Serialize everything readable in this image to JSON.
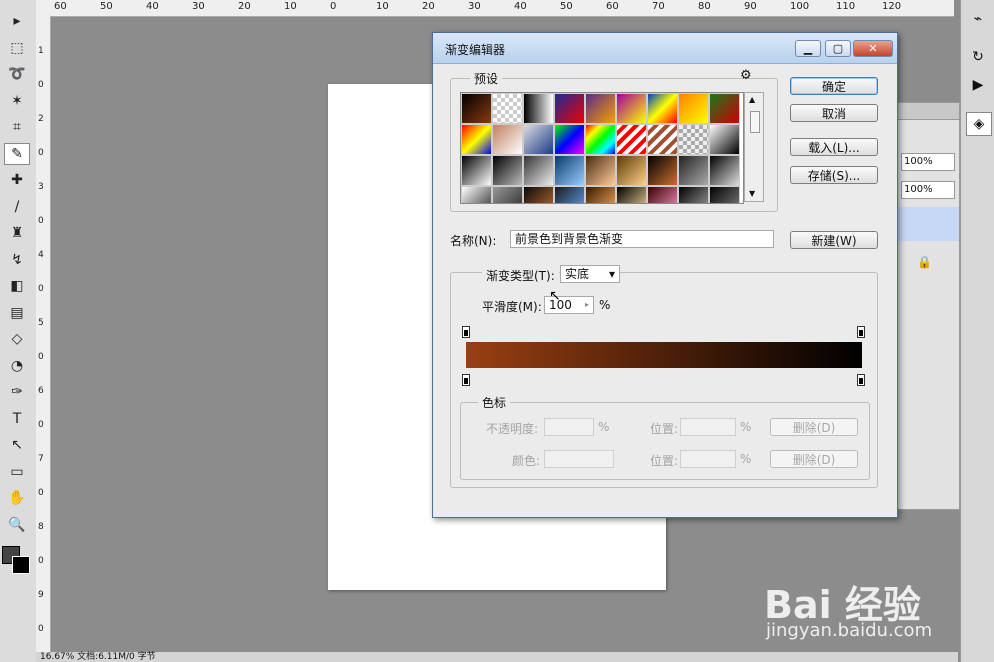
{
  "ruler": {
    "h_ticks": [
      "60",
      "50",
      "40",
      "30",
      "20",
      "10",
      "0",
      "10",
      "20",
      "30",
      "40",
      "50",
      "60",
      "70",
      "80",
      "90",
      "100",
      "110",
      "120"
    ],
    "v_ticks": [
      "1",
      "0",
      "2",
      "0",
      "3",
      "0",
      "4",
      "0",
      "5",
      "0",
      "6",
      "0",
      "7",
      "0",
      "8",
      "0",
      "9",
      "0"
    ]
  },
  "tools": [
    "move-icon",
    "marquee-icon",
    "lasso-icon",
    "magic-wand-icon",
    "crop-icon",
    "eyedropper-icon",
    "healing-icon",
    "brush-icon",
    "stamp-icon",
    "history-brush-icon",
    "eraser-icon",
    "gradient-icon",
    "blur-icon",
    "dodge-icon",
    "pen-icon",
    "type-icon",
    "path-select-icon",
    "shape-icon",
    "hand-icon",
    "zoom-icon"
  ],
  "tool_glyphs": [
    "▸",
    "⬚",
    "➰",
    "✶",
    "⌗",
    "✎",
    "✚",
    "/",
    "♜",
    "↯",
    "◧",
    "▤",
    "◇",
    "◔",
    "✑",
    "T",
    "↖",
    "▭",
    "✋",
    "🔍"
  ],
  "status": {
    "text": "16.67%   文档:6.11M/0 字节"
  },
  "right_panel": {
    "pct1": "100%",
    "pct2": "100%"
  },
  "dialog": {
    "title": "渐变编辑器",
    "presets_label": "预设",
    "ok": "确定",
    "cancel": "取消",
    "load": "载入(L)...",
    "save": "存储(S)...",
    "name_label": "名称(N):",
    "name_value": "前景色到背景色渐变",
    "new": "新建(W)",
    "type_label": "渐变类型(T):",
    "type_value": "实底",
    "smooth_label": "平滑度(M):",
    "smooth_value": "100",
    "percent": "%",
    "stops_label": "色标",
    "opacity_label": "不透明度:",
    "position_label": "位置:",
    "delete": "删除(D)",
    "color_label": "颜色:",
    "delete2": "删除(D)"
  },
  "gradient_colors": {
    "start": "#9a3f12",
    "end": "#000000"
  },
  "watermark": {
    "brand": "Bai 经验",
    "url": "jingyan.baidu.com"
  }
}
